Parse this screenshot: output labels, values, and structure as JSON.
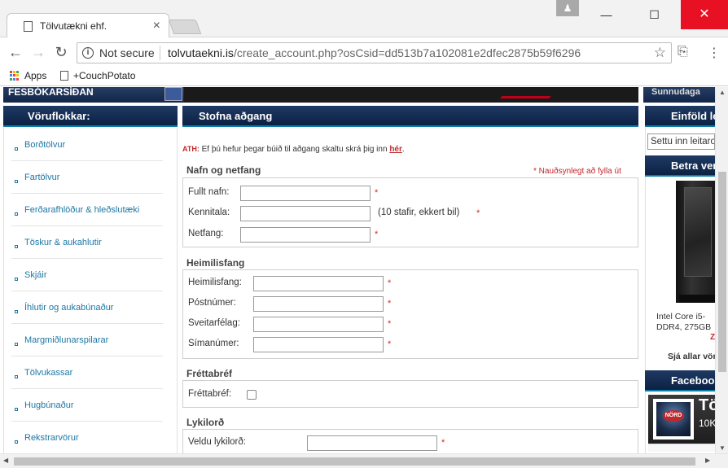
{
  "browser": {
    "tab_title": "Tölvutækni ehf.",
    "tab_close": "×",
    "profile_icon": "person-icon",
    "win_minimize": "—",
    "win_maximize": "☐",
    "win_close": "✕",
    "nav_back": "←",
    "nav_forward": "→",
    "nav_reload": "↻",
    "security_label": "Not secure",
    "url_host": "tolvutaekni.is",
    "url_path": "/create_account.php?osCsid=dd513b7a102081e2dfec2875b59f6296",
    "star": "☆",
    "menu": "⋮",
    "bookmarks": [
      {
        "label": "Apps"
      },
      {
        "label": "+CouchPotato"
      }
    ],
    "apps_colors": [
      "#ea4335",
      "#fbbc05",
      "#34a853",
      "#4285f4",
      "#ea4335",
      "#fbbc05",
      "#34a853",
      "#4285f4",
      "#ea4335"
    ]
  },
  "banner": {
    "left_text": "FESBÓKARSÍÐAN",
    "right_text": "Sunnudaga"
  },
  "left_sidebar": {
    "title": "Vöruflokkar:",
    "items": [
      {
        "label": "Borðtölvur"
      },
      {
        "label": "Fartölvur"
      },
      {
        "label": "Ferðarafhlöður & hleðslutæki"
      },
      {
        "label": "Töskur & aukahlutir"
      },
      {
        "label": "Skjáir"
      },
      {
        "label": "Íhlutir og aukabúnaður"
      },
      {
        "label": "Margmiðlunarspilarar"
      },
      {
        "label": "Tölvukassar"
      },
      {
        "label": "Hugbúnaður"
      },
      {
        "label": "Rekstrarvörur"
      }
    ]
  },
  "form": {
    "title": "Stofna aðgang",
    "notice_prefix": "ATH:",
    "notice_text": " Ef þú hefur þegar búið til aðgang skaltu skrá þig inn ",
    "notice_link": "hér",
    "notice_suffix": ".",
    "required_note": "* Nauðsynlegt að fylla út",
    "required_mark": "*",
    "sections": {
      "name": {
        "title": "Nafn og netfang",
        "full_name_label": "Fullt nafn:",
        "ssn_label": "Kennitala:",
        "ssn_hint": "(10 stafir, ekkert bil)",
        "email_label": "Netfang:"
      },
      "address": {
        "title": "Heimilisfang",
        "address_label": "Heimilisfang:",
        "postcode_label": "Póstnúmer:",
        "city_label": "Sveitarfélag:",
        "phone_label": "Símanúmer:"
      },
      "newsletter": {
        "title": "Fréttabréf",
        "newsletter_label": "Fréttabréf:"
      },
      "password": {
        "title": "Lykilorð",
        "password_label": "Veldu lykilorð:"
      }
    }
  },
  "right_sidebar": {
    "simple_search_title": "Einföld leit",
    "search_placeholder": "Settu inn leitarorð",
    "better_title": "Betra verð",
    "product_line1": "Intel Core i5-",
    "product_line2": "DDR4, 275GB",
    "price_text": "Z",
    "see_all": "Sjá allar vörur",
    "facebook_title": "Facebook",
    "fb_page_name": "Tö",
    "fb_likes": "10K",
    "fb_badge": "NÖRD"
  },
  "colors": {
    "header_dark": "#0c2244",
    "accent_red": "#c1272d",
    "link_blue": "#1c77a4"
  }
}
